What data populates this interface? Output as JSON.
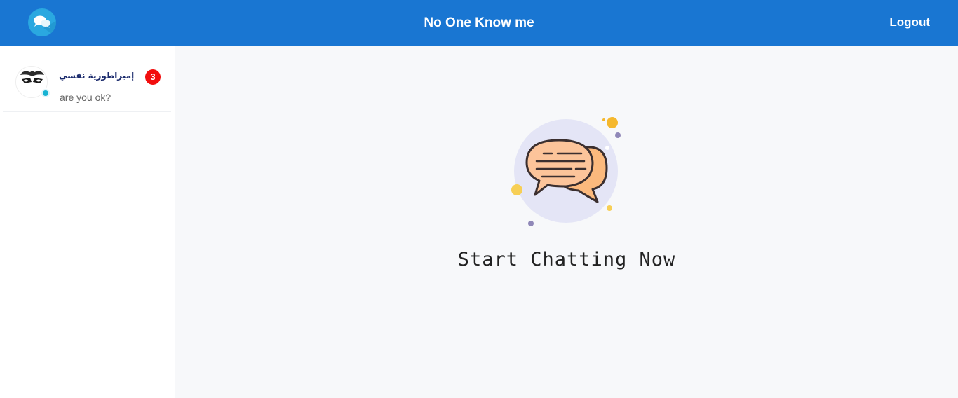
{
  "header": {
    "title": "No One Know me",
    "logout_label": "Logout",
    "logo_icon": "chat-bubbles-icon",
    "bg_color": "#1976d2"
  },
  "sidebar": {
    "chats": [
      {
        "name": "إمبراطورية نفسي",
        "last_message": "are you ok?",
        "unread_count": "3",
        "online": true,
        "avatar_icon": "joker-avatar-icon"
      }
    ]
  },
  "main": {
    "empty_state_text": "Start Chatting Now",
    "illustration_icon": "chat-bubbles-illustration-icon"
  },
  "colors": {
    "accent": "#1976d2",
    "badge": "#f20e0e",
    "online": "#17b3d3"
  }
}
